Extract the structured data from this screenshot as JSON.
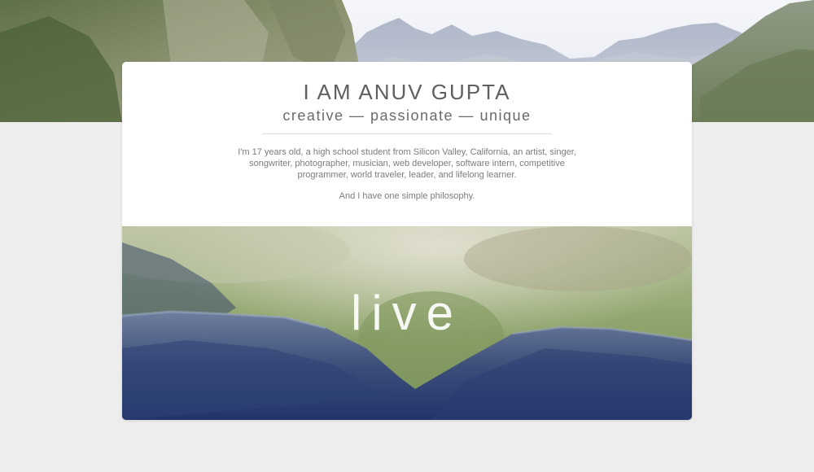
{
  "profile": {
    "name": "I AM ANUV GUPTA",
    "tagline": "creative — passionate — unique",
    "bio": "I'm 17 years old, a high school student from Silicon Valley, California, an artist, singer, songwriter, photographer, musician, web developer, software intern, competitive programmer, world traveler, leader, and lifelong learner.",
    "philosophy": "And I have one simple philosophy."
  },
  "hero": {
    "word": "live"
  },
  "colors": {
    "page_background": "#ededed",
    "card_background": "#ffffff",
    "title_text": "#5f5f5f",
    "body_text": "#7b7b7b"
  }
}
